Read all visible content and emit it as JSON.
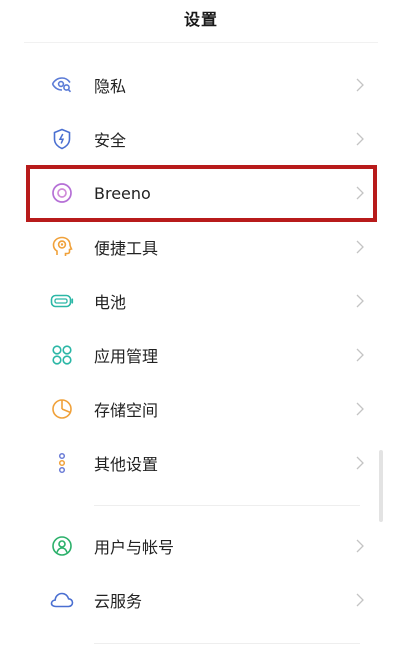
{
  "header": {
    "title": "设置"
  },
  "colors": {
    "highlight": "#b81b1b",
    "chevron": "#c4c4c4"
  },
  "settings": {
    "items": [
      {
        "label": "隐私",
        "icon": "privacy-eye-icon",
        "color": "#5b7bd6"
      },
      {
        "label": "安全",
        "icon": "security-shield-icon",
        "color": "#4a6fd1"
      },
      {
        "label": "Breeno",
        "icon": "breeno-ring-icon",
        "color": "#b56fd6"
      },
      {
        "label": "便捷工具",
        "icon": "convenience-tools-icon",
        "color": "#f0a13a"
      },
      {
        "label": "电池",
        "icon": "battery-icon",
        "color": "#2bb7a6"
      },
      {
        "label": "应用管理",
        "icon": "app-management-icon",
        "color": "#2bb7a6"
      },
      {
        "label": "存储空间",
        "icon": "storage-pie-icon",
        "color": "#f0a13a"
      },
      {
        "label": "其他设置",
        "icon": "other-settings-icon",
        "color": "#6a7bd6"
      }
    ],
    "account_items": [
      {
        "label": "用户与帐号",
        "icon": "user-account-icon",
        "color": "#2bb06a"
      },
      {
        "label": "云服务",
        "icon": "cloud-icon",
        "color": "#4a6fd1"
      }
    ]
  }
}
